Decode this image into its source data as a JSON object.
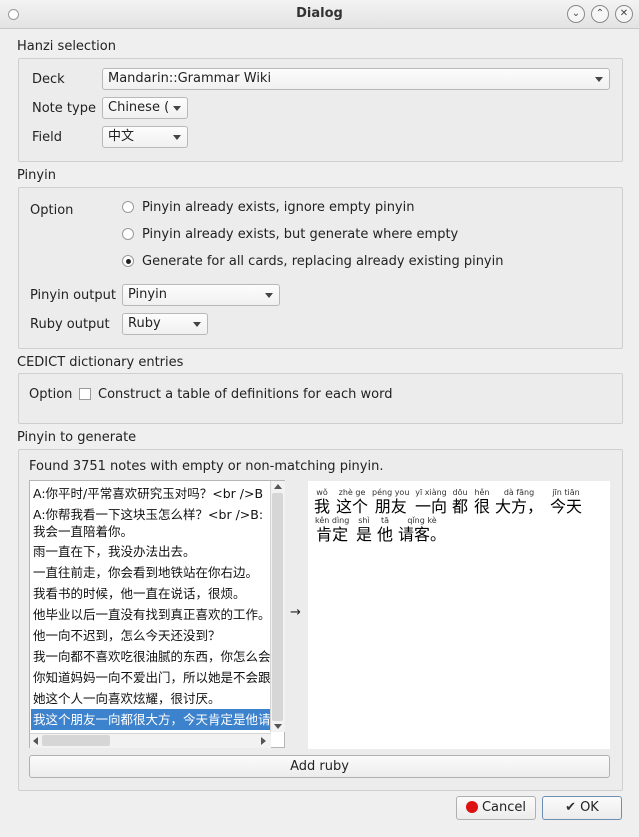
{
  "window": {
    "title": "Dialog"
  },
  "hanzi": {
    "title": "Hanzi selection",
    "deck_label": "Deck",
    "deck_value": "Mandarin::Grammar Wiki",
    "notetype_label": "Note type",
    "notetype_value": "Chinese (",
    "field_label": "Field",
    "field_value": "中文"
  },
  "pinyin": {
    "title": "Pinyin",
    "option_label": "Option",
    "options": [
      {
        "label": "Pinyin already exists, ignore empty pinyin",
        "selected": false
      },
      {
        "label": "Pinyin already exists, but generate where empty",
        "selected": false
      },
      {
        "label": "Generate for all cards, replacing already existing pinyin",
        "selected": true
      }
    ],
    "output_label": "Pinyin output",
    "output_value": "Pinyin",
    "ruby_label": "Ruby output",
    "ruby_value": "Ruby"
  },
  "cedict": {
    "title": "CEDICT dictionary entries",
    "option_label": "Option",
    "checkbox_label": "Construct a table of definitions for each word",
    "checked": false
  },
  "generate": {
    "title": "Pinyin to generate",
    "found_text": "Found 3751 notes with empty or non-matching pinyin.",
    "notes": [
      "A:你平时/平常喜欢研究玉对吗？<br />B",
      "A:你帮我看一下这块玉怎么样？<br />B:",
      "我会一直陪着你。",
      "雨一直在下，我没办法出去。",
      "一直往前走，你会看到地铁站在你右边。",
      "我看书的时候，他一直在说话，很烦。",
      "他毕业以后一直没有找到真正喜欢的工作。",
      "他一向不迟到，怎么今天还没到？",
      "我一向都不喜欢吃很油腻的东西，你怎么会",
      "你知道妈妈一向不爱出门，所以她是不会跟",
      "她这个人一向喜欢炫耀，很讨厌。",
      "我这个朋友一向都很大方，今天肯定是他请"
    ],
    "selected_index": 11,
    "arrow": "→",
    "preview_line1": [
      {
        "py": "wǒ",
        "hz": "我"
      },
      {
        "py": "zhè ge",
        "hz": "这个"
      },
      {
        "py": "péng you",
        "hz": "朋友"
      },
      {
        "py": "yī xiàng",
        "hz": "一向"
      },
      {
        "py": "dōu",
        "hz": "都"
      },
      {
        "py": "hěn",
        "hz": "很"
      },
      {
        "py": "dà fāng",
        "hz": "大方，"
      },
      {
        "py": "jīn tiān",
        "hz": "今天"
      }
    ],
    "preview_line2": [
      {
        "py": "kěn dìng",
        "hz": "肯定"
      },
      {
        "py": "shì",
        "hz": "是"
      },
      {
        "py": "tā",
        "hz": "他"
      },
      {
        "py": "qǐng kè",
        "hz": "请客。"
      }
    ],
    "add_ruby": "Add ruby"
  },
  "buttons": {
    "cancel": "Cancel",
    "ok": "OK"
  }
}
